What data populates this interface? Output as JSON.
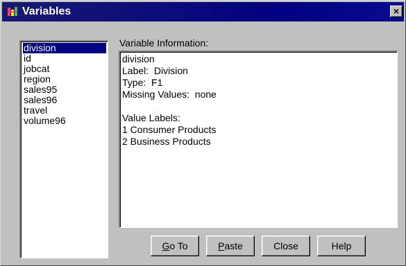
{
  "window": {
    "title": "Variables",
    "close_symbol": "×"
  },
  "variable_list": {
    "items": [
      "division",
      "id",
      "jobcat",
      "region",
      "sales95",
      "sales96",
      "travel",
      "volume96"
    ],
    "selected": "division"
  },
  "info_panel": {
    "label": "Variable Information:",
    "lines": [
      "division",
      "Label:  Division",
      "Type:  F1",
      "Missing Values:  none",
      "",
      "Value Labels:",
      "1 Consumer Products",
      "2 Business Products"
    ]
  },
  "buttons": {
    "go_to": {
      "mnemonic": "G",
      "rest": "o To"
    },
    "paste": {
      "mnemonic": "P",
      "rest": "aste"
    },
    "close": {
      "label": "Close"
    },
    "help": {
      "label": "Help"
    }
  },
  "colors": {
    "titlebar": "#000080",
    "selection": "#000080",
    "face": "#c0c0c0"
  }
}
